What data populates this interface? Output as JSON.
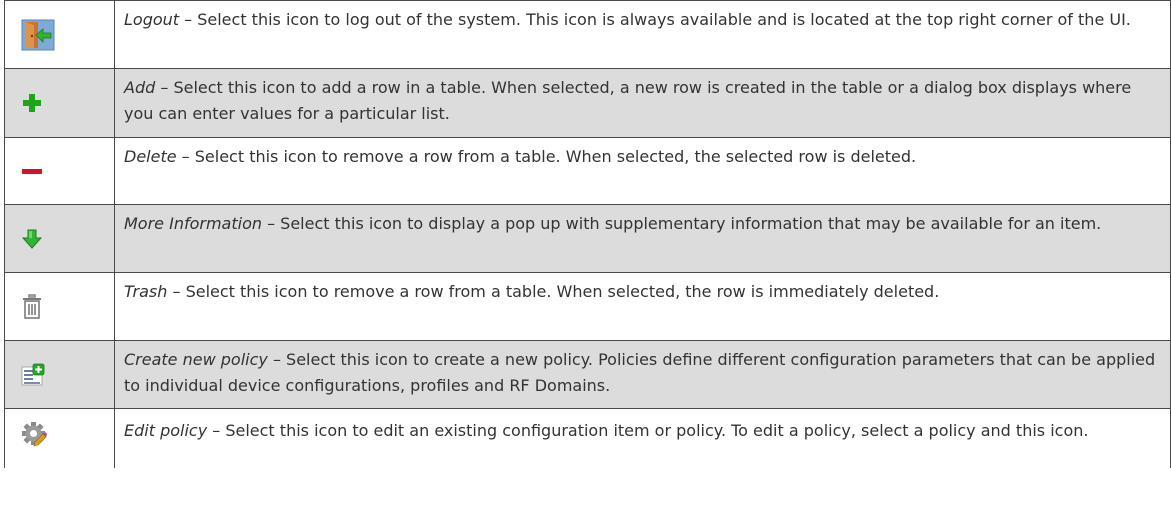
{
  "rows": [
    {
      "icon": "logout-icon",
      "term": "Logout",
      "desc": " – Select this icon to log out of the system. This icon is always available and is located at the top right corner of the UI."
    },
    {
      "icon": "add-icon",
      "term": "Add",
      "desc": " – Select this icon to add a row in a table. When selected, a new row is created in the table or a dialog box displays where you can enter values for a particular list."
    },
    {
      "icon": "delete-icon",
      "term": "Delete",
      "desc": " – Select this icon to remove a row from a table. When selected, the selected row is deleted."
    },
    {
      "icon": "more-information-icon",
      "term": "More Information",
      "desc": " – Select this icon to display a pop up with supplementary information that may be available for an item."
    },
    {
      "icon": "trash-icon",
      "term": "Trash",
      "desc": " – Select this icon to remove a row from a table. When selected, the row is immediately deleted."
    },
    {
      "icon": "create-new-policy-icon",
      "term": "Create new policy",
      "desc": " – Select this icon to create a new policy. Policies define different configuration parameters that can be applied to individual device configurations, profiles and RF Domains."
    },
    {
      "icon": "edit-policy-icon",
      "term": "Edit policy",
      "desc": " – Select this icon to edit an existing configuration item or policy. To edit a policy, select a policy and this icon."
    }
  ],
  "colors": {
    "shaded_row": "#dcdcdc",
    "border": "#4a4a4a",
    "text": "#333333",
    "add_green": "#1aa51a",
    "delete_red": "#d0142a"
  }
}
